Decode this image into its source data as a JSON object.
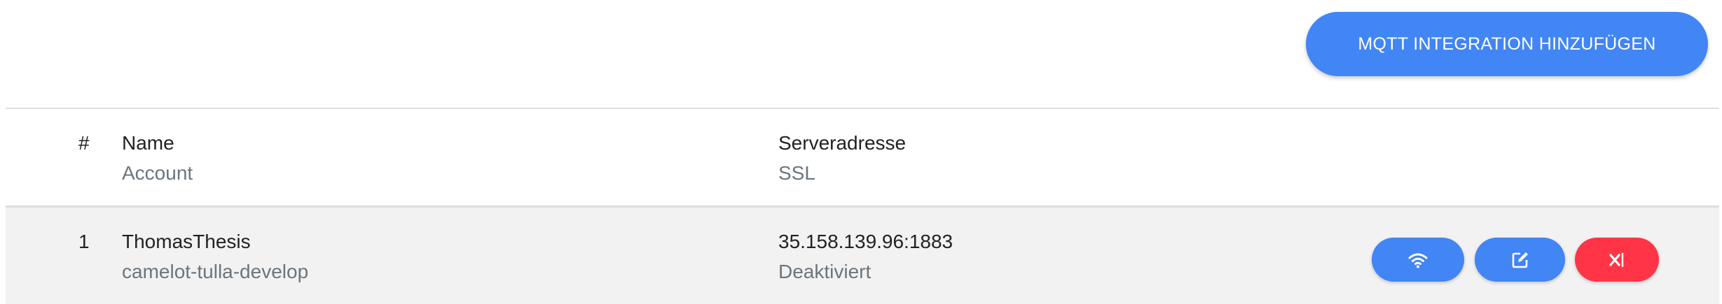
{
  "toolbar": {
    "add_button_label": "MQTT INTEGRATION HINZUFÜGEN"
  },
  "table": {
    "headers": {
      "number": "#",
      "name": "Name",
      "account": "Account",
      "server": "Serveradresse",
      "ssl": "SSL"
    },
    "rows": [
      {
        "number": "1",
        "name": "ThomasThesis",
        "account": "camelot-tulla-develop",
        "server": "35.158.139.96:1883",
        "ssl": "Deaktiviert",
        "actions": {
          "connect_icon": "wifi-icon",
          "edit_icon": "edit-icon",
          "delete_icon": "disconnect-icon"
        }
      }
    ]
  },
  "colors": {
    "primary_button": "#4285f4",
    "danger_button": "#ff3547",
    "row_background": "#f2f2f2"
  }
}
